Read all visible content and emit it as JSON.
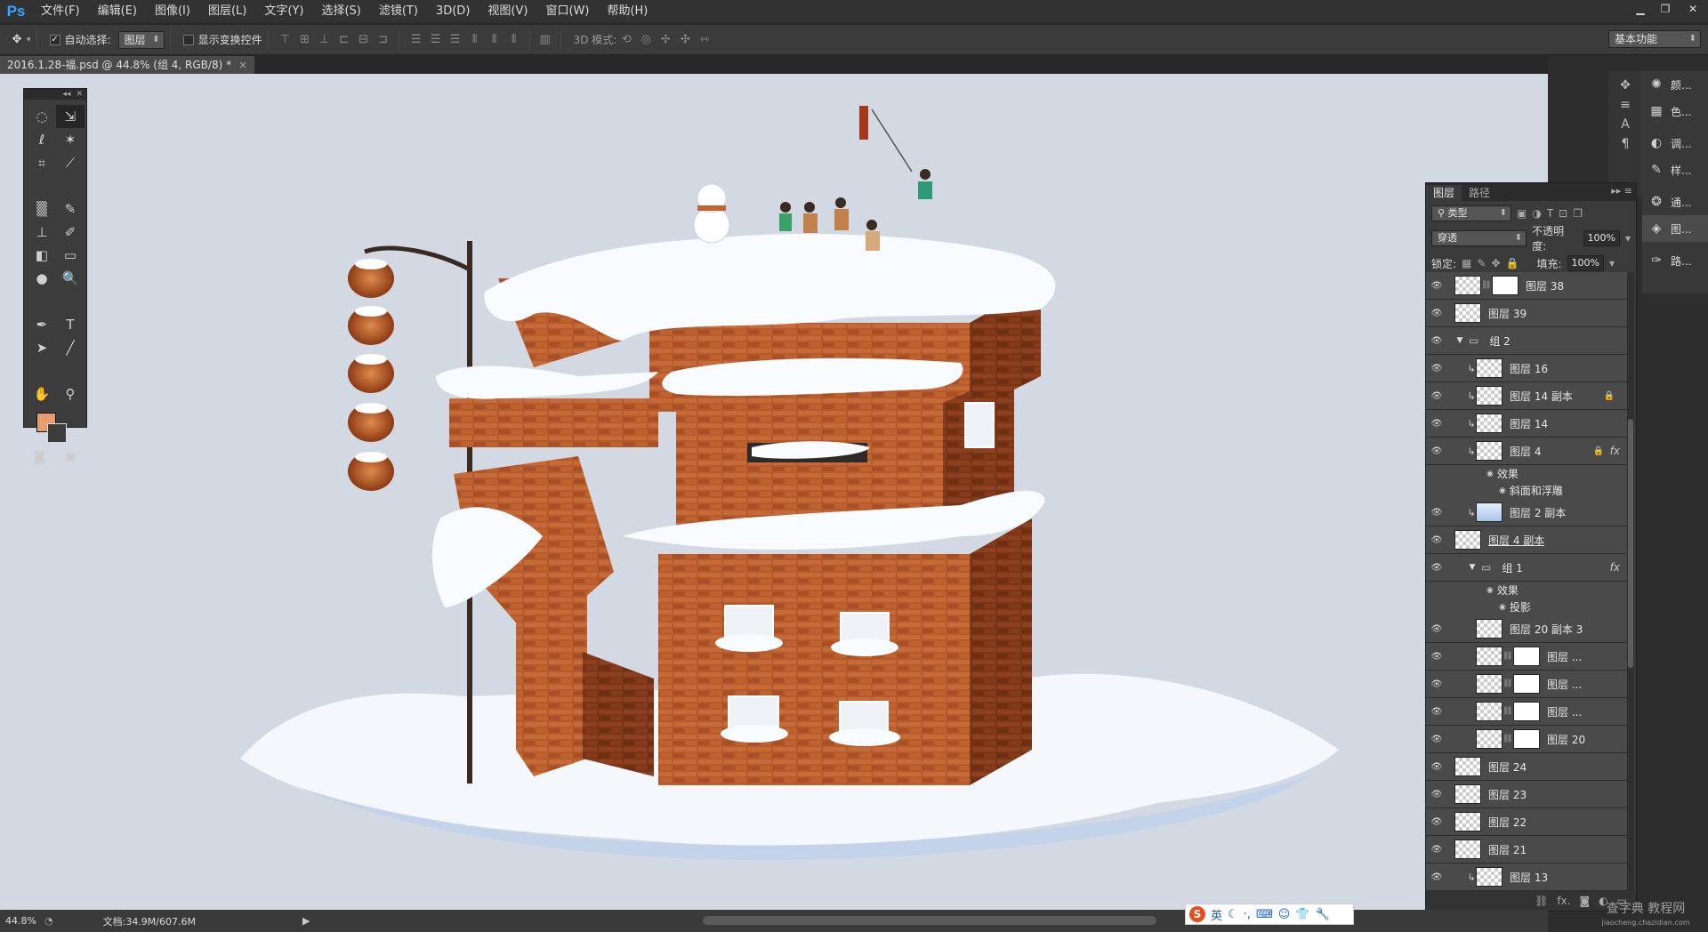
{
  "app": {
    "logo": "Ps"
  },
  "menu": [
    "文件(F)",
    "编辑(E)",
    "图像(I)",
    "图层(L)",
    "文字(Y)",
    "选择(S)",
    "滤镜(T)",
    "3D(D)",
    "视图(V)",
    "窗口(W)",
    "帮助(H)"
  ],
  "window_controls": [
    "minimize-icon",
    "restore-icon",
    "close-icon"
  ],
  "options": {
    "auto_select_label": "自动选择:",
    "auto_select_checked": true,
    "auto_select_target": "图层",
    "show_transform_label": "显示变换控件",
    "show_transform_checked": false,
    "mode_3d_label": "3D 模式:",
    "workspace": "基本功能"
  },
  "document": {
    "tab_title": "2016.1.28-福.psd @ 44.8% (组 4, RGB/8) *"
  },
  "tools_panel": {
    "foreground_color": "#e89e6c",
    "tools": [
      "rectangular-marquee",
      "move",
      "lasso",
      "magic-wand",
      "crop",
      "eyedropper",
      "spot-healing",
      "brush",
      "clone-stamp",
      "history-brush",
      "eraser",
      "gradient",
      "blur",
      "dodge",
      "pen",
      "type",
      "path-selection",
      "line",
      "hand",
      "zoom"
    ]
  },
  "dock": {
    "items": [
      {
        "icon": "palette-icon",
        "label": "颜..."
      },
      {
        "icon": "swatches-icon",
        "label": "色..."
      },
      {
        "icon": "adjust-icon",
        "label": "调..."
      },
      {
        "icon": "styles-icon",
        "label": "样..."
      },
      {
        "icon": "channels-icon",
        "label": "通..."
      },
      {
        "icon": "layers-icon",
        "label": "图..."
      },
      {
        "icon": "paths-icon",
        "label": "路..."
      }
    ]
  },
  "layers_panel": {
    "tabs": [
      "图层",
      "路径"
    ],
    "filter": "类型",
    "blend_mode": "穿透",
    "opacity_label": "不透明度:",
    "opacity": "100%",
    "lock_label": "锁定:",
    "fill_label": "填充:",
    "fill": "100%",
    "layers": [
      {
        "name": "图层 38",
        "indent": 1,
        "kind": "masked"
      },
      {
        "name": "图层 39",
        "indent": 1,
        "kind": "plain"
      },
      {
        "name": "组 2",
        "indent": 1,
        "kind": "group"
      },
      {
        "name": "图层 16",
        "indent": 2,
        "kind": "clipped"
      },
      {
        "name": "图层 14 副本",
        "indent": 2,
        "kind": "clipped",
        "lock": true
      },
      {
        "name": "图层 14",
        "indent": 2,
        "kind": "clipped"
      },
      {
        "name": "图层 4",
        "indent": 2,
        "kind": "clipped",
        "lock": true,
        "fx": "fx"
      },
      {
        "name": "效果",
        "kind": "effect-header"
      },
      {
        "name": "斜面和浮雕",
        "kind": "effect"
      },
      {
        "name": "图层 2 副本",
        "indent": 2,
        "kind": "clipped-blue"
      },
      {
        "name": "图层 4 副本",
        "indent": 1,
        "kind": "plain-underline"
      },
      {
        "name": "组 1",
        "indent": 2,
        "kind": "group",
        "fx": "fx"
      },
      {
        "name": "效果",
        "kind": "effect-header"
      },
      {
        "name": "投影",
        "kind": "effect"
      },
      {
        "name": "图层 20 副本 3",
        "indent": 2,
        "kind": "plain"
      },
      {
        "name": "图层 ...",
        "indent": 2,
        "kind": "masked"
      },
      {
        "name": "图层 ...",
        "indent": 2,
        "kind": "masked"
      },
      {
        "name": "图层 ...",
        "indent": 2,
        "kind": "masked"
      },
      {
        "name": "图层 20",
        "indent": 2,
        "kind": "masked"
      },
      {
        "name": "图层 24",
        "indent": 1,
        "kind": "plain"
      },
      {
        "name": "图层 23",
        "indent": 1,
        "kind": "plain"
      },
      {
        "name": "图层 22",
        "indent": 1,
        "kind": "plain"
      },
      {
        "name": "图层 21",
        "indent": 1,
        "kind": "plain"
      },
      {
        "name": "图层 13",
        "indent": 2,
        "kind": "clipped"
      },
      {
        "name": "",
        "indent": 2,
        "kind": "brick-masked"
      }
    ]
  },
  "status": {
    "zoom": "44.8%",
    "doc_info": "文档:34.9M/607.6M"
  },
  "ime": {
    "logo": "S",
    "lang": "英"
  },
  "watermark": {
    "line1": "查字典 教程网",
    "line2": "jiaocheng.chazidian.com"
  }
}
